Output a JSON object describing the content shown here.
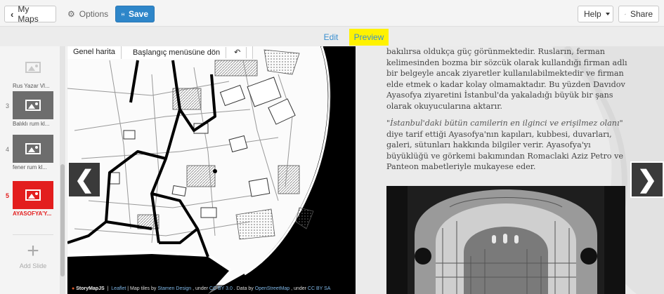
{
  "toolbar": {
    "my_maps_label": "My Maps",
    "options_label": "Options",
    "save_label": "Save",
    "help_label": "Help",
    "share_label": "Share"
  },
  "tabs": {
    "edit_label": "Edit",
    "preview_label": "Preview"
  },
  "sidebar": {
    "slides": [
      {
        "number": "",
        "caption": "Rus Yazar Vl..."
      },
      {
        "number": "3",
        "caption": "Balıklı rum kl..."
      },
      {
        "number": "4",
        "caption": "fener rum kl..."
      },
      {
        "number": "5",
        "caption": "AYASOFYA'Y..."
      }
    ],
    "add_slide_label": "Add Slide"
  },
  "map": {
    "overview_label": "Genel harita",
    "home_label": "Başlangıç menüsüne dön",
    "attribution": {
      "brand": "StoryMapJS",
      "leaflet": "Leaflet",
      "tiles_text": " | Map tiles by ",
      "stamen": "Stamen Design",
      "under_1": ", under ",
      "ccby": "CC BY 3.0",
      "data_by": ". Data by ",
      "osm": "OpenStreetMap",
      "under_2": ", under ",
      "ccbysa": "CC BY SA"
    }
  },
  "story": {
    "paragraph1": "bakılırsa oldukça güç görünmektedir. Rusların, ferman kelimesinden bozma bir sözcük olarak kullandığı firman adlı bir belgeyle ancak ziyaretler kullanılabilmektedir ve firman elde etmek o kadar kolay olmamaktadır. Bu yüzden Davıdov Ayasofya ziyaretini İstanbul'da yakaladığı büyük bir şans olarak okuyucularına aktarır.",
    "quote": "\"İstanbul'daki bütün camilerin en ilginci ve erişilmez olanı\"",
    "paragraph2": " diye tarif ettiği Ayasofya'nın kapıları, kubbesi, duvarları, galeri, sütunları hakkında bilgiler verir. Ayasofya'yı büyüklüğü ve görkemi bakımından Romaclaki Aziz Petro ve Panteon mabetleriyle mukayese eder."
  },
  "navigation": {
    "prev_glyph": "❮",
    "next_glyph": "❯"
  }
}
